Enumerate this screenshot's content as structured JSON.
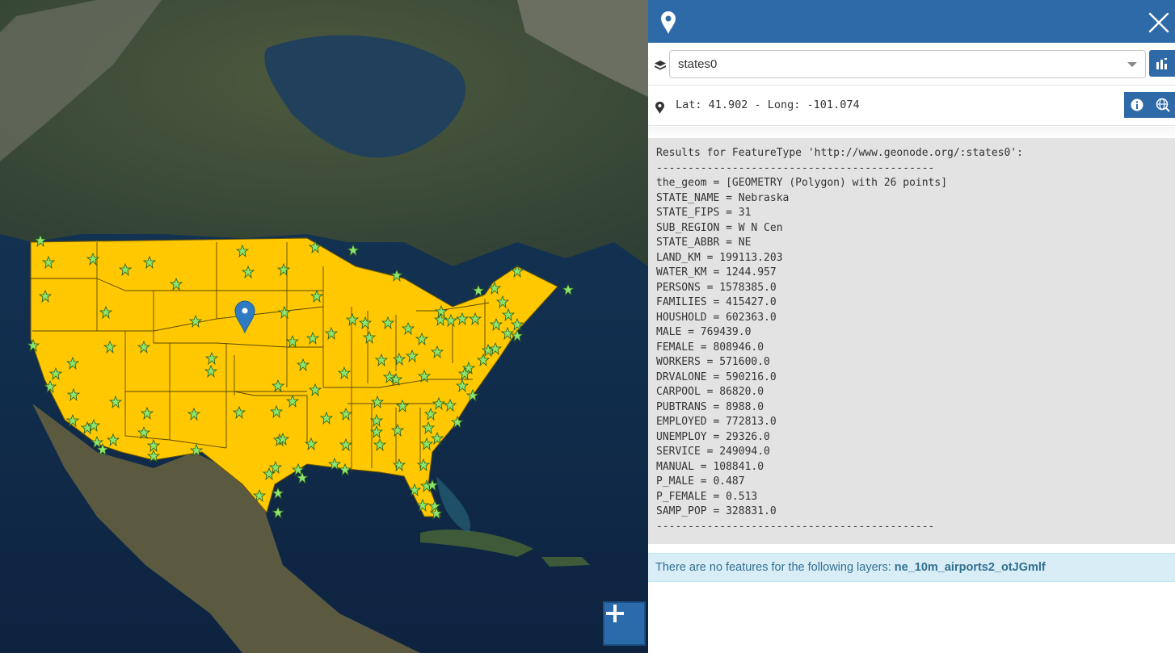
{
  "map": {
    "marker": "map-pin-marker-icon",
    "zoom_in_icon": "plus-icon",
    "colors": {
      "states_fill": "#ffc800",
      "states_stroke": "#5a4a00",
      "stars": "#8ce66e",
      "marker": "#2e7bc4",
      "ocean": "#0f2a4a"
    }
  },
  "panel": {
    "header_icon": "map-marker-icon",
    "close_icon": "close-icon",
    "layer_icon": "layers-icon",
    "layer_select": {
      "value": "states0"
    },
    "stats_icon": "chart-icon",
    "coords_icon": "map-marker-icon",
    "coords": "Lat: 41.902 - Long: -101.074",
    "info_icon": "info-icon",
    "globe_icon": "globe-search-icon",
    "results": {
      "lines": [
        "Results for FeatureType 'http://www.geonode.org/:states0':",
        "--------------------------------------------",
        "the_geom = [GEOMETRY (Polygon) with 26 points]",
        "STATE_NAME = Nebraska",
        "STATE_FIPS = 31",
        "SUB_REGION = W N Cen",
        "STATE_ABBR = NE",
        "LAND_KM = 199113.203",
        "WATER_KM = 1244.957",
        "PERSONS = 1578385.0",
        "FAMILIES = 415427.0",
        "HOUSHOLD = 602363.0",
        "MALE = 769439.0",
        "FEMALE = 808946.0",
        "WORKERS = 571600.0",
        "DRVALONE = 590216.0",
        "CARPOOL = 86820.0",
        "PUBTRANS = 8988.0",
        "EMPLOYED = 772813.0",
        "UNEMPLOY = 29326.0",
        "SERVICE = 249094.0",
        "MANUAL = 108841.0",
        "P_MALE = 0.487",
        "P_FEMALE = 0.513",
        "SAMP_POP = 328831.0",
        "--------------------------------------------"
      ]
    },
    "alert": {
      "prefix": "There are no features for the following layers: ",
      "layer": "ne_10m_airports2_otJGmlf"
    }
  }
}
